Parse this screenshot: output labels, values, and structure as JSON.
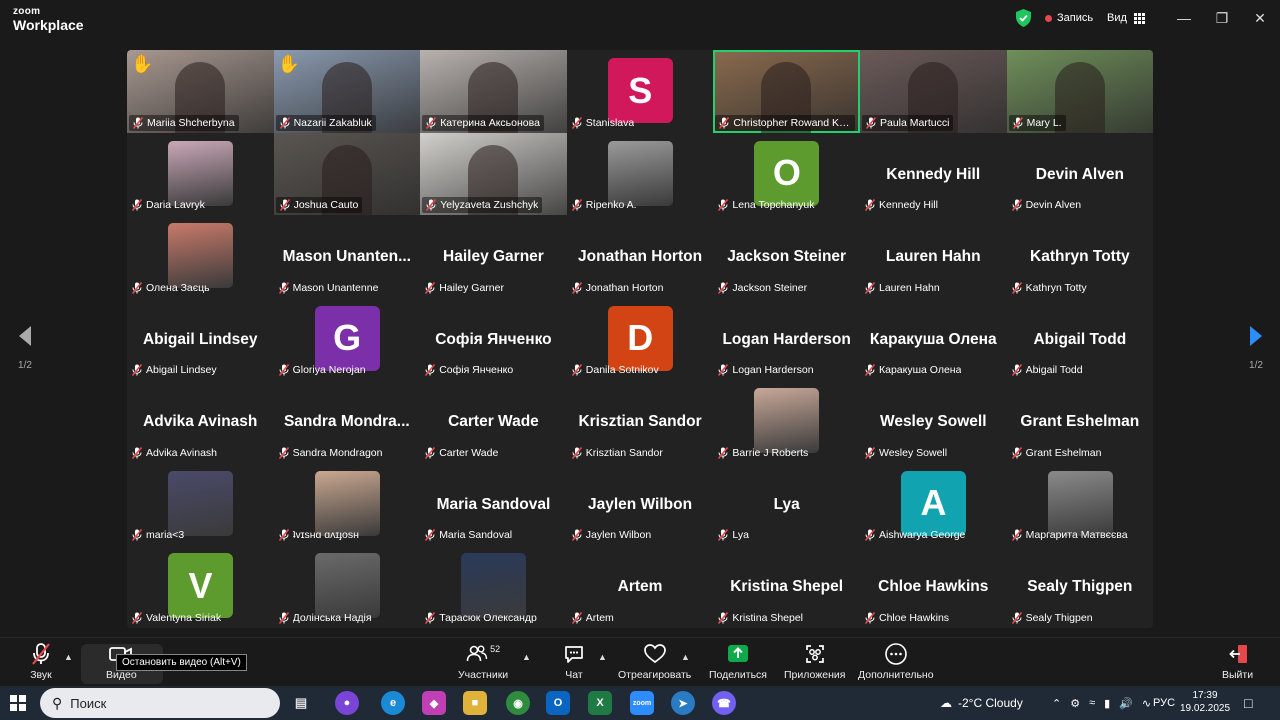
{
  "app": {
    "logo_top": "zoom",
    "logo_bottom": "Workplace"
  },
  "titlebar": {
    "record_label": "Запись",
    "view_label": "Вид"
  },
  "pagination": {
    "left": "1/2",
    "right": "1/2"
  },
  "participants": [
    {
      "name": "Mariia Shcherbyna",
      "kind": "video",
      "bg": "#a89890",
      "hand": true
    },
    {
      "name": "Nazarii Zakabluk",
      "kind": "video",
      "bg": "#8a9ab0",
      "hand": true
    },
    {
      "name": "Катерина Аксьонова",
      "kind": "video",
      "bg": "#b8b2ae"
    },
    {
      "name": "Stanislava",
      "kind": "letter",
      "letter": "S",
      "color": "#d1185b"
    },
    {
      "name": "Christopher Rowand Kelley",
      "kind": "video",
      "bg": "#8a6a4e",
      "active": true
    },
    {
      "name": "Paula Martucci",
      "kind": "video",
      "bg": "#6a5a58"
    },
    {
      "name": "Mary L.",
      "kind": "video",
      "bg": "#6f8f5a"
    },
    {
      "name": "Daria Lavryk",
      "kind": "photo",
      "color": "#c9a8b8"
    },
    {
      "name": "Joshua Cauto",
      "kind": "video",
      "bg": "#5a5550"
    },
    {
      "name": "Yelyzaveta Zushchyk",
      "kind": "video",
      "bg": "#d2d0cc"
    },
    {
      "name": "Ripenko A.",
      "kind": "photo",
      "color": "#9a9a9a"
    },
    {
      "name": "Lena Topchanyuk",
      "kind": "letter",
      "letter": "O",
      "color": "#5e9b2e"
    },
    {
      "name": "Kennedy Hill",
      "kind": "name"
    },
    {
      "name": "Devin Alven",
      "kind": "name"
    },
    {
      "name": "Олена Заєць",
      "kind": "photo",
      "color": "#c97a6a"
    },
    {
      "name": "Mason Unantenne",
      "kind": "name",
      "big": "Mason Unanten..."
    },
    {
      "name": "Hailey Garner",
      "kind": "name"
    },
    {
      "name": "Jonathan Horton",
      "kind": "name"
    },
    {
      "name": "Jackson Steiner",
      "kind": "name"
    },
    {
      "name": "Lauren Hahn",
      "kind": "name"
    },
    {
      "name": "Kathryn Totty",
      "kind": "name"
    },
    {
      "name": "Abigail Lindsey",
      "kind": "name"
    },
    {
      "name": "Gloriya Nerojan",
      "kind": "letter",
      "letter": "G",
      "color": "#7b2fa8"
    },
    {
      "name": "Софія Янченко",
      "kind": "name"
    },
    {
      "name": "Danila Sotnikov",
      "kind": "letter",
      "letter": "D",
      "color": "#d24413"
    },
    {
      "name": "Logan Harderson",
      "kind": "name"
    },
    {
      "name": "Каракуша Олена",
      "kind": "name"
    },
    {
      "name": "Abigail Todd",
      "kind": "name"
    },
    {
      "name": "Advika Avinash",
      "kind": "name"
    },
    {
      "name": "Sandra Mondragon",
      "kind": "name",
      "big": "Sandra Mondra..."
    },
    {
      "name": "Carter Wade",
      "kind": "name"
    },
    {
      "name": "Krisztian Sandor",
      "kind": "name"
    },
    {
      "name": "Barrie J Roberts",
      "kind": "photo",
      "color": "#c8a898"
    },
    {
      "name": "Wesley Sowell",
      "kind": "name"
    },
    {
      "name": "Grant Eshelman",
      "kind": "name"
    },
    {
      "name": "maria<3",
      "kind": "photo",
      "color": "#4a4a6a"
    },
    {
      "name": "ʇvɪsнɑ ɑʌɪɟosн",
      "kind": "photo",
      "color": "#c9a890"
    },
    {
      "name": "Maria Sandoval",
      "kind": "name"
    },
    {
      "name": "Jaylen Wilbon",
      "kind": "name"
    },
    {
      "name": "Lya",
      "kind": "name"
    },
    {
      "name": "Aishwarya George",
      "kind": "letter",
      "letter": "A",
      "color": "#12a3b0"
    },
    {
      "name": "Маргарита Матвєєва",
      "kind": "photo",
      "color": "#8a8a8a"
    },
    {
      "name": "Valentyna Siriak",
      "kind": "letter",
      "letter": "V",
      "color": "#5e9b2e"
    },
    {
      "name": "Долінська Надія",
      "kind": "photo",
      "color": "#6a6a6a"
    },
    {
      "name": "Тарасюк Олександр",
      "kind": "photo",
      "color": "#2a3a5a"
    },
    {
      "name": "Artem",
      "kind": "name"
    },
    {
      "name": "Kristina Shepel",
      "kind": "name"
    },
    {
      "name": "Chloe Hawkins",
      "kind": "name"
    },
    {
      "name": "Sealy Thigpen",
      "kind": "name"
    }
  ],
  "toolbar": {
    "audio": "Звук",
    "video": "Видео",
    "tooltip": "Остановить видео (Alt+V)",
    "participants": "Участники",
    "participants_count": "52",
    "chat": "Чат",
    "react": "Отреагировать",
    "share": "Поделиться",
    "apps": "Приложения",
    "more": "Дополнительно",
    "leave": "Выйти"
  },
  "taskbar": {
    "search_placeholder": "Поиск",
    "weather": "-2°C  Cloudy",
    "lang": "РУС",
    "time": "17:39",
    "date": "19.02.2025"
  },
  "colors": {
    "active_speaker": "#21d16e",
    "share": "#0ea94a",
    "accent_blue": "#2d8cff"
  }
}
